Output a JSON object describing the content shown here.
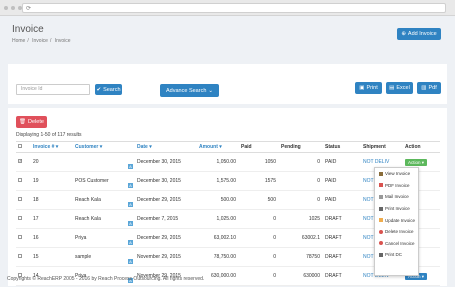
{
  "page": {
    "title": "Invoice",
    "breadcrumb": [
      "Home",
      "Invoice",
      "Invoice"
    ],
    "add_label": "Add Invoice"
  },
  "search": {
    "placeholder": "Invoice Id",
    "search_label": "Search",
    "advanced_label": "Advance Search",
    "print_label": "Print",
    "excel_label": "Excel",
    "pdf_label": "Pdf"
  },
  "grid": {
    "delete_label": "Delete",
    "displaying": "Displaying 1-50 of 117 results",
    "columns": [
      "Invoice #",
      "Customer",
      "Date",
      "Amount",
      "Paid",
      "Pending",
      "Status",
      "Shipment",
      "Action"
    ],
    "rows": [
      {
        "checked": true,
        "invoice": "20",
        "customer": "",
        "date": "December 30, 2015",
        "amount": "1,050.00",
        "paid": "1050",
        "pending": "0",
        "status": "PAID",
        "shipment": "NOT DELIV",
        "action": "Action"
      },
      {
        "checked": false,
        "invoice": "19",
        "customer": "POS Customer",
        "date": "December 30, 2015",
        "amount": "1,575.00",
        "paid": "1575",
        "pending": "0",
        "status": "PAID",
        "shipment": "NOT DE",
        "action": ""
      },
      {
        "checked": false,
        "invoice": "18",
        "customer": "Reach Kala",
        "date": "December 29, 2015",
        "amount": "500.00",
        "paid": "500",
        "pending": "0",
        "status": "PAID",
        "shipment": "NOT DE",
        "action": ""
      },
      {
        "checked": false,
        "invoice": "17",
        "customer": "Reach Kala",
        "date": "December 7, 2015",
        "amount": "1,025.00",
        "paid": "0",
        "pending": "1025",
        "status": "DRAFT",
        "shipment": "NOT DE",
        "action": ""
      },
      {
        "checked": false,
        "invoice": "16",
        "customer": "Priya",
        "date": "December 29, 2015",
        "amount": "63,002.10",
        "paid": "0",
        "pending": "63002.1",
        "status": "DRAFT",
        "shipment": "NOT DE",
        "action": ""
      },
      {
        "checked": false,
        "invoice": "15",
        "customer": "sample",
        "date": "November 29, 2015",
        "amount": "78,750.00",
        "paid": "0",
        "pending": "78750",
        "status": "DRAFT",
        "shipment": "NOT DE",
        "action": ""
      },
      {
        "checked": false,
        "invoice": "14",
        "customer": "Priya",
        "date": "November 29, 2015",
        "amount": "630,000.00",
        "paid": "0",
        "pending": "630000",
        "status": "DRAFT",
        "shipment": "NOT DELIV",
        "action": "Action"
      }
    ]
  },
  "dropdown": {
    "items": [
      "View Invoice",
      "PDF Invoice",
      "Mail Invoice",
      "Print Invoice",
      "Update Invoice",
      "Delete Invoice",
      "Cancel Invoice",
      "Print DC"
    ]
  },
  "footer": {
    "prefix": "Copyrights © ReachERP 2005 - 2016 by Reach Process Outsourcing. All rights reserved."
  },
  "colors": {
    "primary": "#2f83c2",
    "danger": "#e0505b",
    "success": "#5cb85c"
  }
}
